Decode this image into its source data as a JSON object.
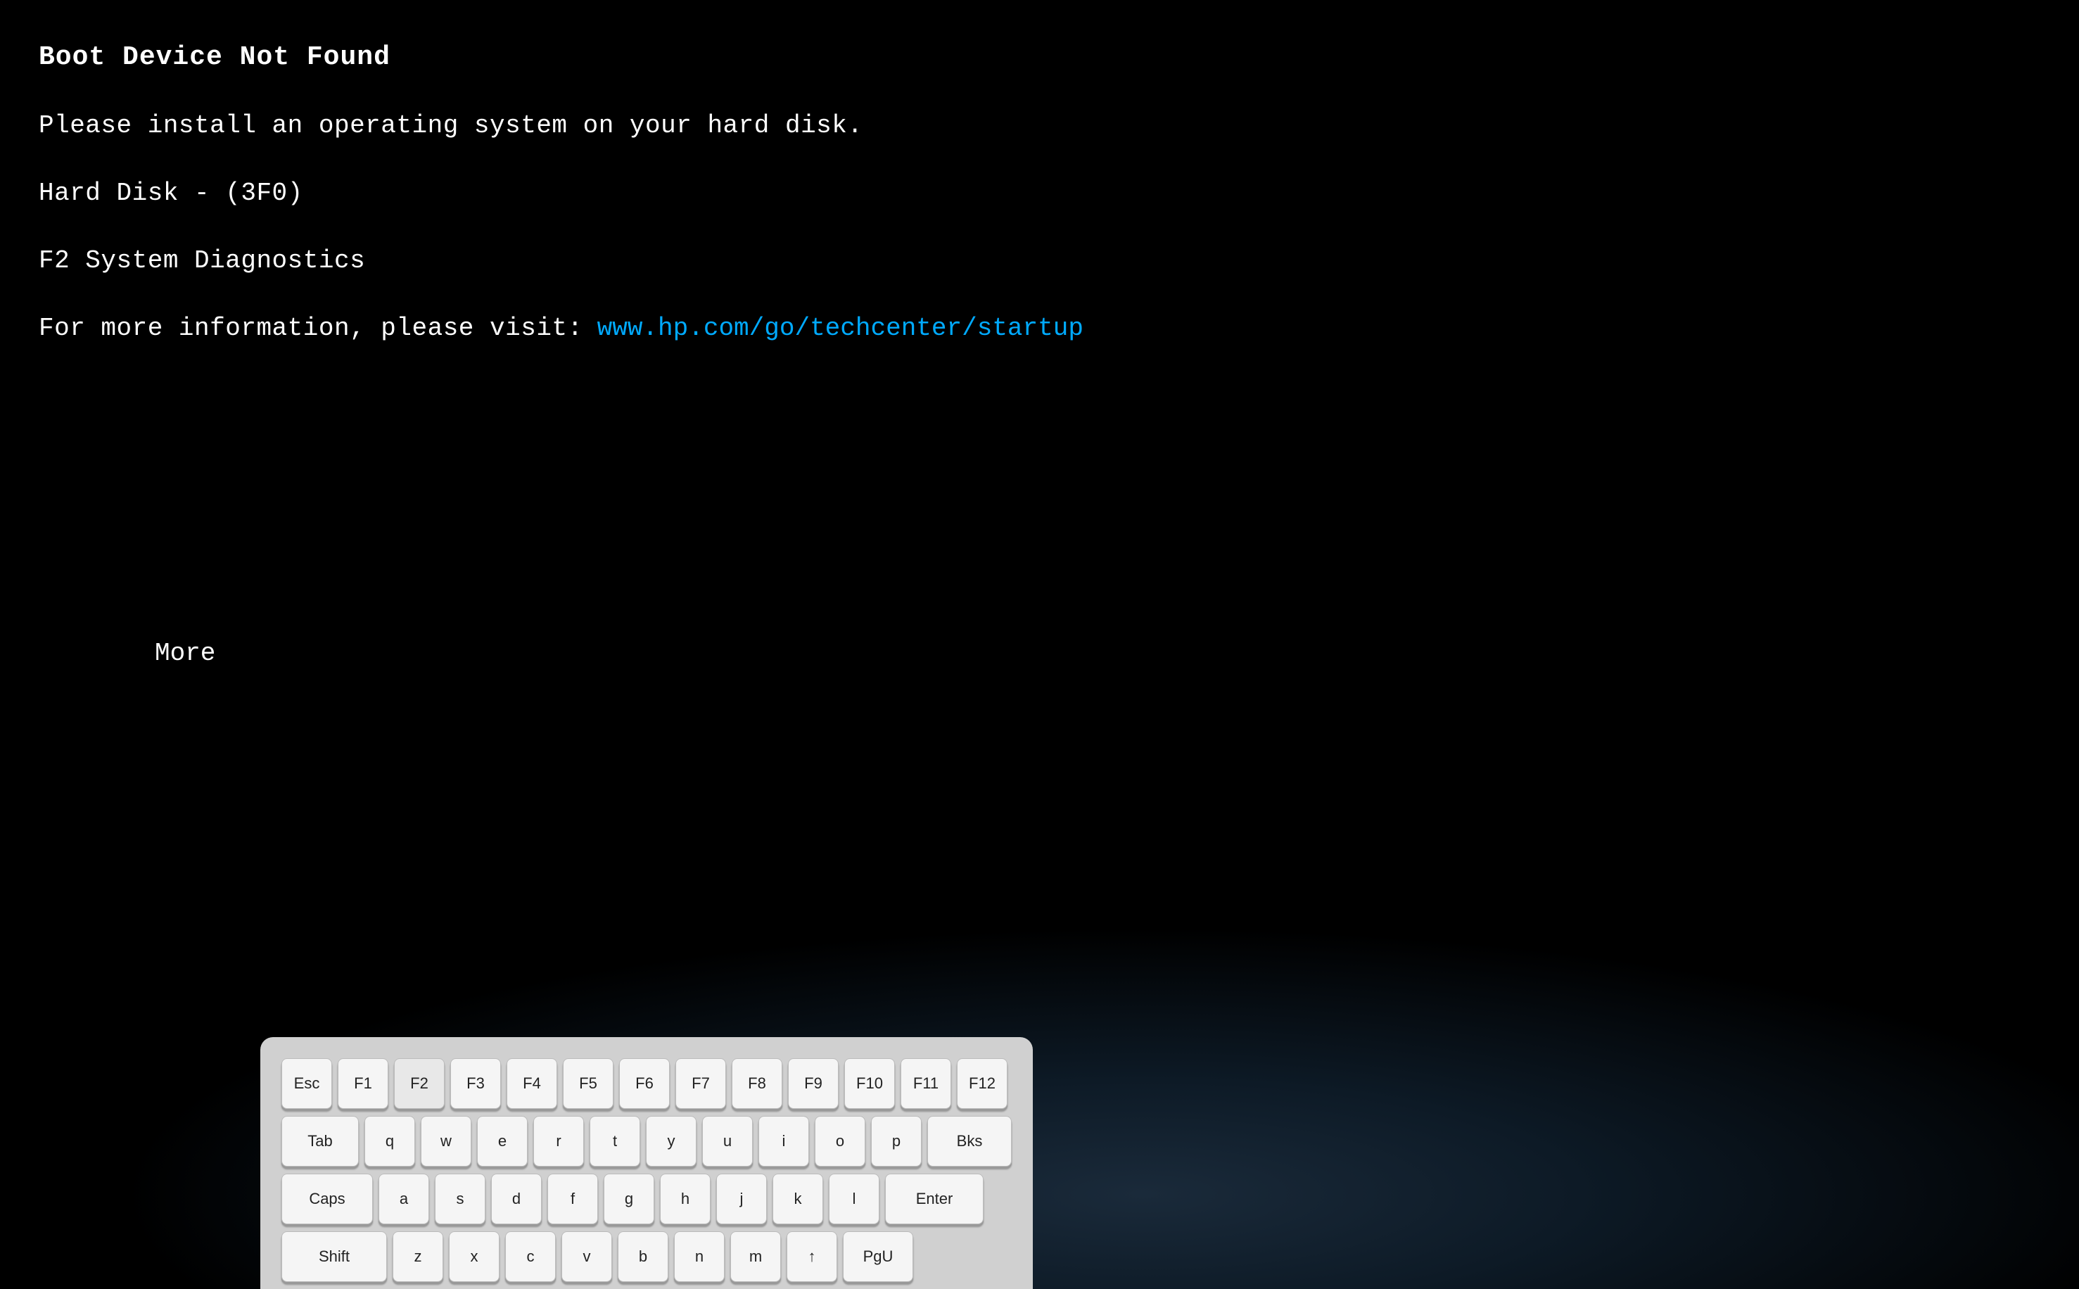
{
  "screen": {
    "background_color": "#000000",
    "lines": {
      "title": "Boot Device Not Found",
      "install_msg": "Please install an operating system on your hard disk.",
      "hard_disk": "Hard Disk - (3F0)",
      "f2_label": "F2    System Diagnostics",
      "visit_label": "For more information, please visit:",
      "visit_url": "www.hp.com/go/techcenter/startup",
      "more": "More"
    }
  },
  "keyboard": {
    "rows": [
      {
        "keys": [
          {
            "label": "Esc",
            "size": "normal"
          },
          {
            "label": "F1",
            "size": "normal"
          },
          {
            "label": "F2",
            "size": "normal"
          },
          {
            "label": "F3",
            "size": "normal"
          },
          {
            "label": "F4",
            "size": "normal"
          },
          {
            "label": "F5",
            "size": "normal"
          },
          {
            "label": "F6",
            "size": "normal"
          },
          {
            "label": "F7",
            "size": "normal"
          },
          {
            "label": "F8",
            "size": "normal"
          },
          {
            "label": "F9",
            "size": "normal"
          },
          {
            "label": "F10",
            "size": "normal"
          },
          {
            "label": "F11",
            "size": "normal"
          },
          {
            "label": "F12",
            "size": "normal"
          }
        ]
      },
      {
        "keys": [
          {
            "label": "Tab",
            "size": "tab"
          },
          {
            "label": "q",
            "size": "normal"
          },
          {
            "label": "w",
            "size": "normal"
          },
          {
            "label": "e",
            "size": "normal"
          },
          {
            "label": "r",
            "size": "normal"
          },
          {
            "label": "t",
            "size": "normal"
          },
          {
            "label": "y",
            "size": "normal"
          },
          {
            "label": "u",
            "size": "normal"
          },
          {
            "label": "i",
            "size": "normal"
          },
          {
            "label": "o",
            "size": "normal"
          },
          {
            "label": "p",
            "size": "normal"
          },
          {
            "label": "Bks",
            "size": "bks"
          }
        ]
      },
      {
        "keys": [
          {
            "label": "Caps",
            "size": "caps"
          },
          {
            "label": "a",
            "size": "normal"
          },
          {
            "label": "s",
            "size": "normal"
          },
          {
            "label": "d",
            "size": "normal"
          },
          {
            "label": "f",
            "size": "normal"
          },
          {
            "label": "g",
            "size": "normal"
          },
          {
            "label": "h",
            "size": "normal"
          },
          {
            "label": "j",
            "size": "normal"
          },
          {
            "label": "k",
            "size": "normal"
          },
          {
            "label": "l",
            "size": "normal"
          },
          {
            "label": "Enter",
            "size": "enter"
          }
        ]
      },
      {
        "keys": [
          {
            "label": "Shift",
            "size": "shift"
          },
          {
            "label": "z",
            "size": "normal"
          },
          {
            "label": "x",
            "size": "normal"
          },
          {
            "label": "c",
            "size": "normal"
          },
          {
            "label": "v",
            "size": "normal"
          },
          {
            "label": "b",
            "size": "normal"
          },
          {
            "label": "n",
            "size": "normal"
          },
          {
            "label": "m",
            "size": "normal"
          },
          {
            "label": "↑",
            "size": "normal"
          },
          {
            "label": "PgU",
            "size": "pgu"
          }
        ]
      }
    ]
  }
}
